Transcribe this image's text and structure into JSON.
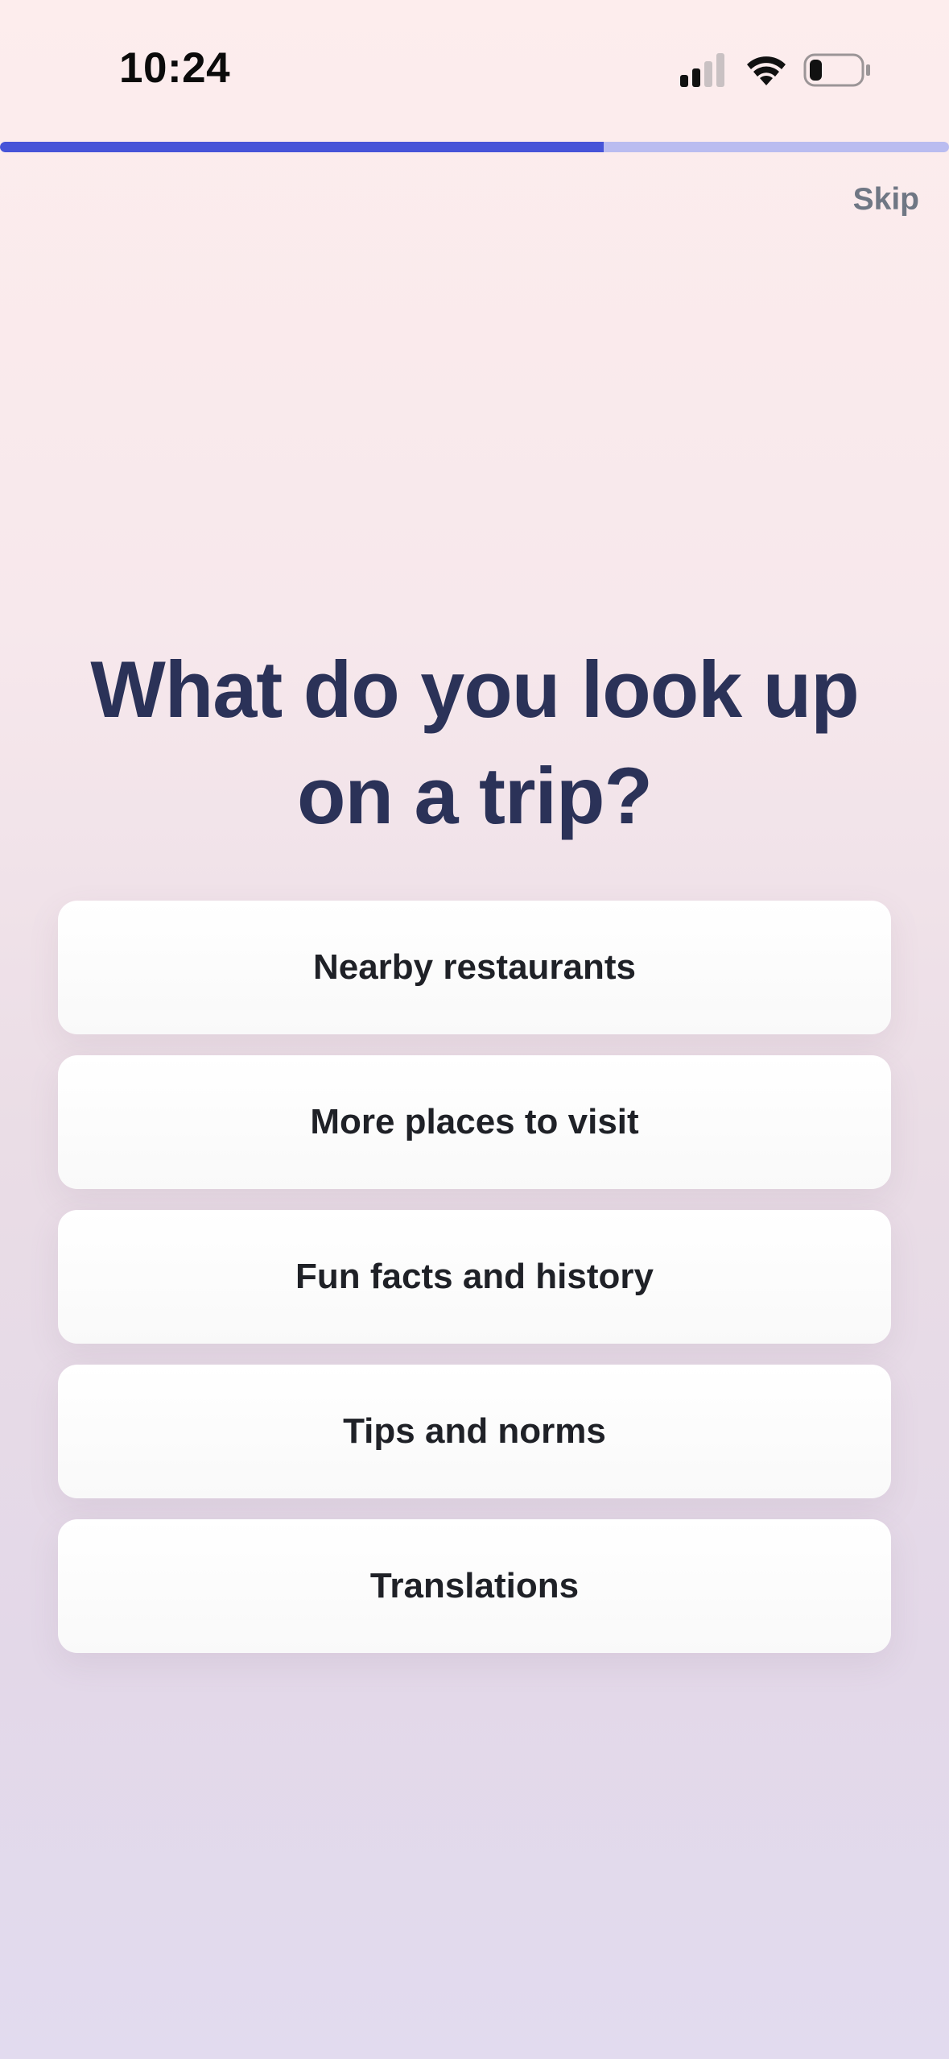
{
  "status_bar": {
    "time": "10:24",
    "signal_icon": "cellular-signal-icon",
    "wifi_icon": "wifi-icon",
    "battery_icon": "battery-icon",
    "signal_bars_active": 2,
    "signal_bars_total": 4
  },
  "progress": {
    "fraction": 0.636,
    "fill_color": "#4754d8",
    "track_color": "#babcf0"
  },
  "header": {
    "skip_label": "Skip"
  },
  "main": {
    "title": "What do you look up on a trip?",
    "options": [
      {
        "label": "Nearby restaurants"
      },
      {
        "label": "More places to visit"
      },
      {
        "label": "Fun facts and history"
      },
      {
        "label": "Tips and norms"
      },
      {
        "label": "Translations"
      }
    ]
  },
  "colors": {
    "title": "#2b3258",
    "skip": "#6f7784",
    "option_text": "#1f2127"
  }
}
